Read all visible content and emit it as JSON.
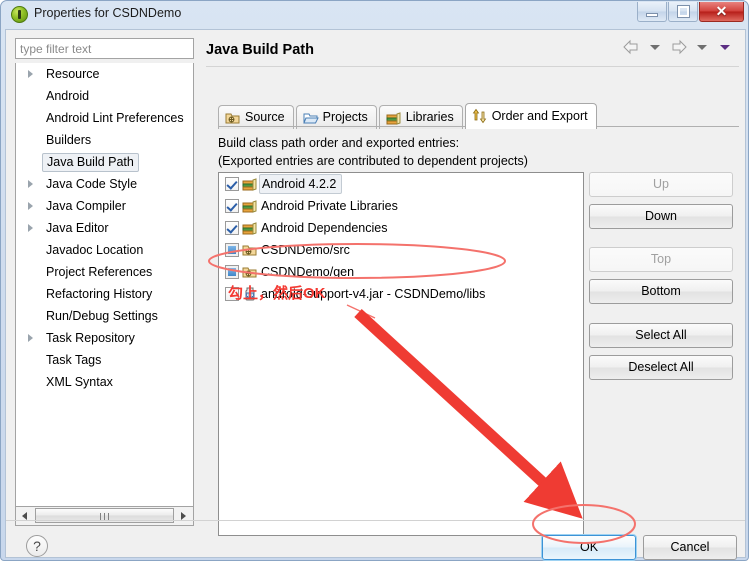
{
  "window": {
    "title": "Properties for CSDNDemo",
    "icon": "eclipse-icon",
    "controls": {
      "minimize": "minimize-icon",
      "maximize": "maximize-icon",
      "close": "✕"
    }
  },
  "filter": {
    "placeholder": "type filter text",
    "value": ""
  },
  "sidebar": {
    "items": [
      {
        "label": "Resource",
        "expandable": true
      },
      {
        "label": "Android",
        "expandable": false
      },
      {
        "label": "Android Lint Preferences",
        "expandable": false
      },
      {
        "label": "Builders",
        "expandable": false
      },
      {
        "label": "Java Build Path",
        "expandable": false,
        "selected": true
      },
      {
        "label": "Java Code Style",
        "expandable": true
      },
      {
        "label": "Java Compiler",
        "expandable": true
      },
      {
        "label": "Java Editor",
        "expandable": true
      },
      {
        "label": "Javadoc Location",
        "expandable": false
      },
      {
        "label": "Project References",
        "expandable": false
      },
      {
        "label": "Refactoring History",
        "expandable": false
      },
      {
        "label": "Run/Debug Settings",
        "expandable": false
      },
      {
        "label": "Task Repository",
        "expandable": true
      },
      {
        "label": "Task Tags",
        "expandable": false
      },
      {
        "label": "XML Syntax",
        "expandable": false
      }
    ]
  },
  "page": {
    "title": "Java Build Path",
    "nav": {
      "back": "back-arrow-icon",
      "back_menu": "chevron-down-icon",
      "forward": "forward-arrow-icon",
      "forward_menu": "chevron-down-icon",
      "view_menu": "view-menu-icon"
    }
  },
  "tabs": [
    {
      "label": "Source",
      "icon": "source-folder-icon",
      "active": false
    },
    {
      "label": "Projects",
      "icon": "projects-folder-icon",
      "active": false
    },
    {
      "label": "Libraries",
      "icon": "libraries-icon",
      "active": false
    },
    {
      "label": "Order and Export",
      "icon": "order-export-icon",
      "active": true
    }
  ],
  "descriptions": {
    "line1": "Build class path order and exported entries:",
    "line2": "(Exported entries are contributed to dependent projects)"
  },
  "entries": [
    {
      "label": "Android 4.2.2",
      "icon": "library-icon",
      "checkbox": "checked",
      "selected": true
    },
    {
      "label": "Android Private Libraries",
      "icon": "library-icon",
      "checkbox": "checked",
      "selected": false
    },
    {
      "label": "Android Dependencies",
      "icon": "library-icon",
      "checkbox": "checked",
      "selected": false
    },
    {
      "label": "CSDNDemo/src",
      "icon": "package-folder-icon",
      "checkbox": "filled",
      "selected": false
    },
    {
      "label": "CSDNDemo/gen",
      "icon": "package-folder-icon",
      "checkbox": "filled",
      "selected": false
    },
    {
      "label": "android-support-v4.jar - CSDNDemo/libs",
      "icon": "jar-icon",
      "checkbox": "unchecked",
      "selected": false,
      "highlighted": true
    }
  ],
  "side_buttons": [
    {
      "label": "Up",
      "enabled": false
    },
    {
      "label": "Down",
      "enabled": true
    },
    {
      "label": "Top",
      "enabled": false
    },
    {
      "label": "Bottom",
      "enabled": true
    },
    {
      "label": "Select All",
      "enabled": true
    },
    {
      "label": "Deselect All",
      "enabled": true
    }
  ],
  "footer": {
    "help": "?",
    "ok": "OK",
    "cancel": "Cancel"
  },
  "annotations": {
    "note": "勾上，然后OK",
    "color": "#f43a33",
    "marks": [
      "ellipse-around-jar-entry",
      "arrow-to-ok-button",
      "ellipse-around-ok-button"
    ]
  }
}
